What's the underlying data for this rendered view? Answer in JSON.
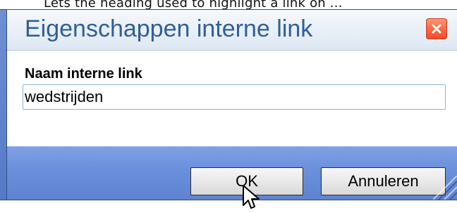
{
  "background": {
    "partial_text": "Lets the heading used to highlight a link on ..."
  },
  "dialog": {
    "title": "Eigenschappen interne link",
    "fields": {
      "link_name": {
        "label": "Naam interne link",
        "value": "wedstrijden"
      }
    },
    "buttons": {
      "ok": "OK",
      "cancel": "Annuleren"
    },
    "icons": {
      "close": "close-icon",
      "resize": "resize-grip-icon",
      "cursor": "mouse-cursor-icon"
    },
    "colors": {
      "title": "#2f5f97",
      "footer": "#6a8fdb",
      "close": "#f04b2b"
    }
  }
}
